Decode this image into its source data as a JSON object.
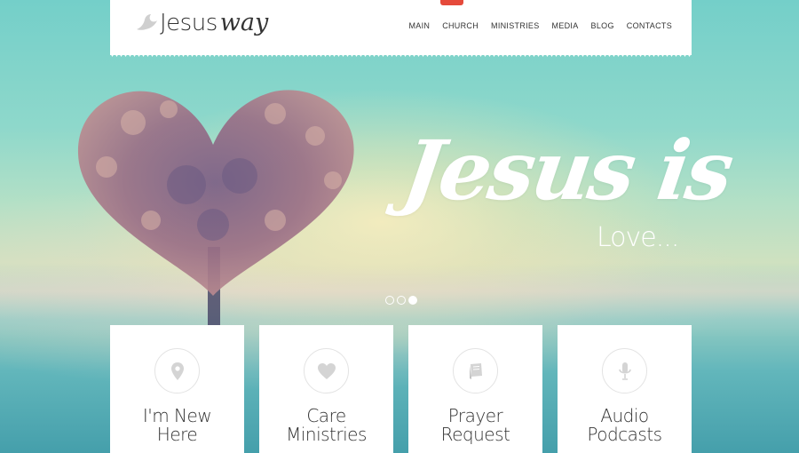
{
  "brand": {
    "word1": "Jesus",
    "word2": "way",
    "logo_icon": "dove-icon"
  },
  "nav": {
    "items": [
      "MAIN",
      "CHURCH",
      "MINISTRIES",
      "MEDIA",
      "BLOG",
      "CONTACTS"
    ],
    "accent_color": "#e54a3b"
  },
  "hero": {
    "title": "Jesus is",
    "subtitle": "Love...",
    "slides_total": 3,
    "active_slide": 3
  },
  "cards": [
    {
      "line1": "I'm New",
      "line2": "Here",
      "icon": "map-pin-icon"
    },
    {
      "line1": "Care",
      "line2": "Ministries",
      "icon": "heart-icon"
    },
    {
      "line1": "Prayer",
      "line2": "Request",
      "icon": "book-icon"
    },
    {
      "line1": "Audio",
      "line2": "Podcasts",
      "icon": "microphone-icon"
    }
  ],
  "colors": {
    "card_background": "#ffffff",
    "icon_gray": "#d4d4d4",
    "text_dark": "#333333"
  }
}
